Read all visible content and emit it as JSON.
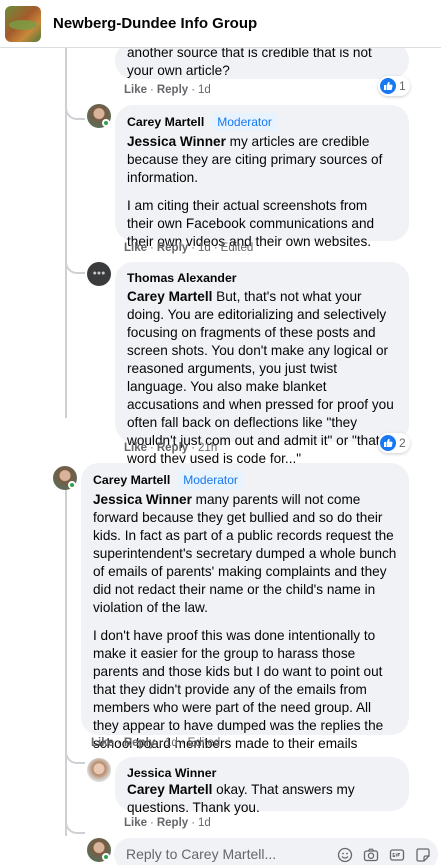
{
  "header": {
    "title": "Newberg-Dundee Info Group"
  },
  "comments": [
    {
      "text_lines": [
        "another source that is credible that is not",
        "your own article?"
      ],
      "actions": {
        "like": "Like",
        "reply": "Reply",
        "time": "1d",
        "edited": ""
      },
      "reaction_count": "1"
    },
    {
      "author": "Carey Martell",
      "badge": "Moderator",
      "mention": "Jessica Winner",
      "text": "my articles are credible because they are citing primary sources of information.",
      "text2": "I am citing their actual screenshots from their own Facebook communications and their own videos and their own websites.",
      "actions": {
        "like": "Like",
        "reply": "Reply",
        "time": "1d",
        "edited": "Edited"
      }
    },
    {
      "author": "Thomas Alexander",
      "mention": "Carey Martell",
      "text": "But, that's not what your doing. You are editorializing and selectively focusing on fragments of these posts and screen shots. You don't make any logical or reasoned arguments, you just twist language. You also make blanket accusations and when pressed for proof you often fall back on deflections like \"they wouldn't just com out and admit it\" or \"that word they used is code for...\"",
      "actions": {
        "like": "Like",
        "reply": "Reply",
        "time": "21h",
        "edited": ""
      },
      "reaction_count": "2"
    },
    {
      "author": "Carey Martell",
      "badge": "Moderator",
      "mention": "Jessica Winner",
      "text": "many parents will not come forward because they get bullied and so do their kids. In fact as part of a public records request the superintendent's secretary dumped a whole bunch of emails of parents' making complaints and they did not redact their name or the child's name in violation of the law.",
      "text2": "I don't have proof this was done intentionally to make it easier for the group to harass those parents and those kids but I do want to point out that they didn't provide any of the emails from members who were part of the need group. All they appear to have dumped was the replies the school board members made to their emails",
      "actions": {
        "like": "Like",
        "reply": "Reply",
        "time": "1d",
        "edited": "Edited"
      }
    },
    {
      "author": "Jessica Winner",
      "mention": "Carey Martell",
      "text": "okay. That answers my questions. Thank you.",
      "actions": {
        "like": "Like",
        "reply": "Reply",
        "time": "1d",
        "edited": ""
      }
    }
  ],
  "reply_box": {
    "placeholder": "Reply to Carey Martell..."
  },
  "icons": [
    "like-icon",
    "emoji-icon",
    "camera-icon",
    "gif-icon",
    "sticker-icon"
  ],
  "colors": {
    "accent": "#1877f2",
    "bubble": "#f0f2f5",
    "online": "#31a24c"
  }
}
